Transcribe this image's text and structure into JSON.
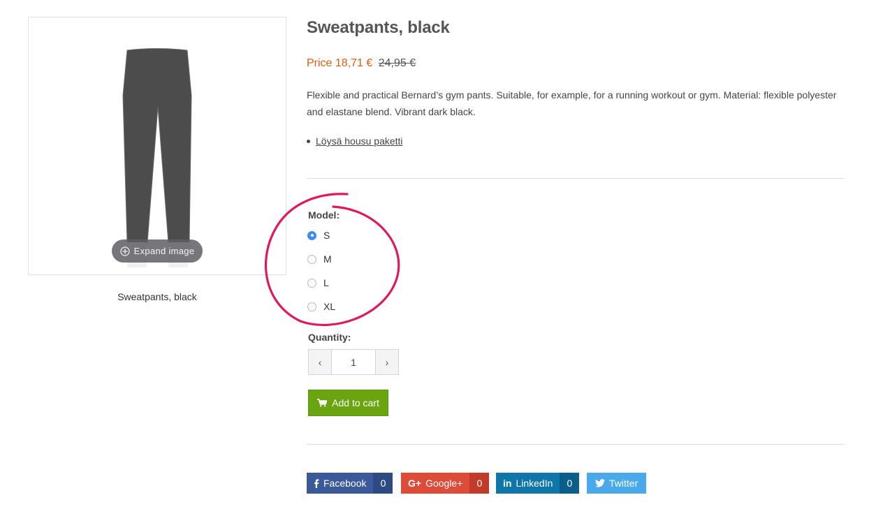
{
  "product": {
    "title": "Sweatpants, black",
    "caption": "Sweatpants, black",
    "expand_label": "Expand image",
    "price_label": "Price 18,71 €",
    "old_price": "24,95 €",
    "description": "Flexible and practical Bernard’s gym pants. Suitable, for example, for a running workout or gym. Material: flexible polyester and elastane blend. Vibrant dark black.",
    "bundle_link": "Löysä housu paketti"
  },
  "model": {
    "label": "Model:",
    "options": [
      {
        "label": "S",
        "selected": true
      },
      {
        "label": "M",
        "selected": false
      },
      {
        "label": "L",
        "selected": false
      },
      {
        "label": "XL",
        "selected": false
      }
    ]
  },
  "quantity": {
    "label": "Quantity:",
    "value": "1",
    "decrement": "‹",
    "increment": "›"
  },
  "cart": {
    "label": "Add to cart",
    "icon": "cart-icon"
  },
  "share": {
    "facebook": {
      "label": "Facebook",
      "count": "0",
      "icon": "facebook-icon"
    },
    "googleplus": {
      "label": "Google+",
      "count": "0",
      "icon": "googleplus-icon"
    },
    "linkedin": {
      "label": "LinkedIn",
      "count": "0",
      "icon": "linkedin-icon"
    },
    "twitter": {
      "label": "Twitter",
      "icon": "twitter-icon"
    }
  },
  "colors": {
    "price": "#e25c0b",
    "cart": "#6aa510",
    "facebook": "#3b5998",
    "googleplus": "#dd4b39",
    "linkedin": "#0e76a8",
    "twitter": "#49a9ea",
    "annotation": "#e0195f",
    "radio_selected": "#3b8cf5"
  }
}
